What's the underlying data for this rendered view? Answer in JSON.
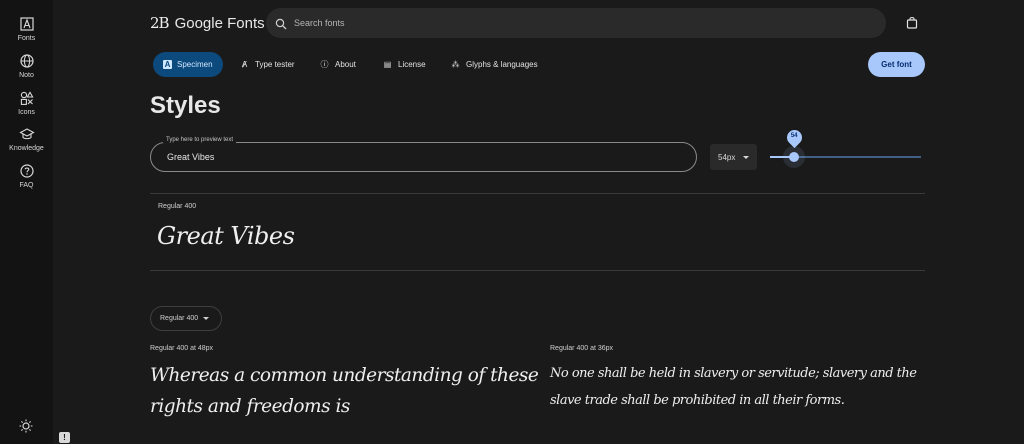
{
  "rail": {
    "items": [
      {
        "label": "Fonts",
        "icon": "font-icon"
      },
      {
        "label": "Noto",
        "icon": "globe-icon"
      },
      {
        "label": "Icons",
        "icon": "shapes-icon"
      },
      {
        "label": "Knowledge",
        "icon": "school-icon"
      },
      {
        "label": "FAQ",
        "icon": "help-icon"
      }
    ],
    "theme_icon": "sun-icon",
    "feedback_icon_text": "!"
  },
  "header": {
    "logo_mark": "2B",
    "logo_text": "Google Fonts",
    "search_placeholder": "Search fonts",
    "bag_icon": "shopping-bag-icon"
  },
  "tabs": [
    {
      "label": "Specimen",
      "active": true,
      "icon": "specimen-icon",
      "glyph": "A"
    },
    {
      "label": "Type tester",
      "active": false,
      "icon": "type-tester-icon",
      "glyph": "Ⱥ"
    },
    {
      "label": "About",
      "active": false,
      "icon": "info-icon",
      "glyph": "ⓘ"
    },
    {
      "label": "License",
      "active": false,
      "icon": "license-icon",
      "glyph": "▤"
    },
    {
      "label": "Glyphs & languages",
      "active": false,
      "icon": "glyphs-icon",
      "glyph": "⁂"
    }
  ],
  "get_font_label": "Get font",
  "styles": {
    "title": "Styles",
    "preview_label": "Type here to preview text",
    "preview_value": "Great Vibes",
    "size_select": "54px",
    "slider_value": "54",
    "slider_fraction": 0.16,
    "style_name": "Regular 400",
    "style_sample": "Great Vibes"
  },
  "samples": {
    "weight_select": "Regular 400",
    "cards": [
      {
        "label": "Regular 400 at 48px",
        "text": "Whereas a common understanding of these rights and freedoms is"
      },
      {
        "label": "Regular 400 at 36px",
        "text": "No one shall be held in slavery or servitude; slavery and the slave trade shall be prohibited in all their forms."
      }
    ]
  },
  "colors": {
    "accent": "#a8c7fa",
    "active_tab_bg": "#0c4a7d",
    "background": "#1a1a1a",
    "rail": "#131313"
  }
}
